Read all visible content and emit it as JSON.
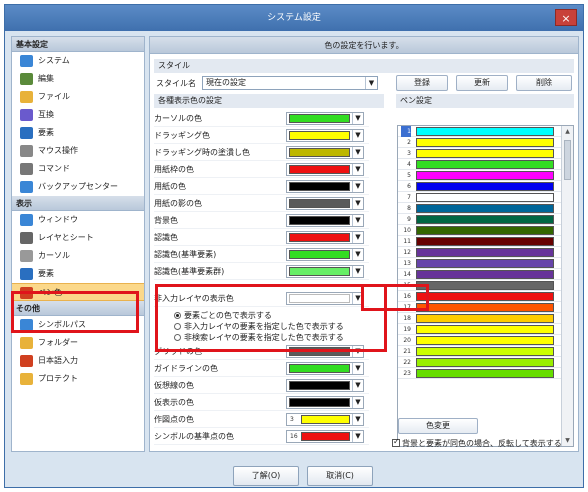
{
  "window": {
    "title": "システム設定",
    "close": "×"
  },
  "left": {
    "sections": [
      {
        "header": "基本設定",
        "items": [
          {
            "label": "システム",
            "icon": "monitor-icon"
          },
          {
            "label": "編集",
            "icon": "pencil-icon"
          },
          {
            "label": "ファイル",
            "icon": "folder-icon"
          },
          {
            "label": "互換",
            "icon": "compat-icon"
          },
          {
            "label": "要素",
            "icon": "element-icon"
          },
          {
            "label": "マウス操作",
            "icon": "mouse-icon"
          },
          {
            "label": "コマンド",
            "icon": "gear-icon"
          },
          {
            "label": "バックアップセンター",
            "icon": "backup-icon"
          }
        ]
      },
      {
        "header": "表示",
        "items": [
          {
            "label": "ウィンドウ",
            "icon": "window-icon"
          },
          {
            "label": "レイヤとシート",
            "icon": "layers-icon"
          },
          {
            "label": "カーソル",
            "icon": "cursor-icon"
          },
          {
            "label": "要素",
            "icon": "element-icon"
          },
          {
            "label": "ペン色",
            "icon": "pen-color-icon",
            "selected": true
          }
        ]
      },
      {
        "header": "その他",
        "items": [
          {
            "label": "シンボルパス",
            "icon": "symbol-icon"
          },
          {
            "label": "フォルダー",
            "icon": "folder-icon"
          },
          {
            "label": "日本語入力",
            "icon": "ime-icon"
          },
          {
            "label": "プロテクト",
            "icon": "lock-icon"
          }
        ]
      }
    ]
  },
  "right": {
    "header": "色の設定を行います。",
    "style_section": "スタイル",
    "style_name_label": "スタイル名",
    "style_name_value": "現在の設定",
    "buttons": {
      "register": "登録",
      "update": "更新",
      "delete": "削除"
    },
    "colors_section": "各種表示色の設定",
    "pen_section": "ペン設定",
    "color_rows": [
      {
        "label": "カーソルの色",
        "color": "#33dd22"
      },
      {
        "label": "ドラッギング色",
        "color": "#ffff00"
      },
      {
        "label": "ドラッギング時の塗潰し色",
        "color": "#bdb700"
      },
      {
        "label": "用紙枠の色",
        "color": "#ee1111"
      },
      {
        "label": "用紙の色",
        "color": "#000000"
      },
      {
        "label": "用紙の影の色",
        "color": "#5a5a5a"
      },
      {
        "label": "背景色",
        "color": "#000000"
      },
      {
        "label": "認識色",
        "color": "#ee1111"
      },
      {
        "label": "認識色(基準要素)",
        "color": "#33dd22"
      },
      {
        "label": "認識色(基準要素群)",
        "color": "#66ee66"
      }
    ],
    "inactive_layer": {
      "label": "非入力レイヤの表示色",
      "color": "#ffffff",
      "options": [
        {
          "label": "要素ごとの色で表示する",
          "checked": true
        },
        {
          "label": "非入力レイヤの要素を指定した色で表示する",
          "checked": false
        },
        {
          "label": "非検索レイヤの要素を指定した色で表示する",
          "checked": false
        }
      ]
    },
    "color_rows_2": [
      {
        "label": "グリッドの色",
        "color": "#5a5a5a"
      },
      {
        "label": "ガイドラインの色",
        "color": "#33dd22"
      },
      {
        "label": "仮想線の色",
        "color": "#000000"
      },
      {
        "label": "仮表示の色",
        "color": "#000000"
      },
      {
        "label": "作図点の色",
        "color": "#ffff00",
        "num": "3"
      },
      {
        "label": "シンボルの基準点の色",
        "color": "#ee1111",
        "num": "16"
      }
    ],
    "pens": [
      {
        "num": "1",
        "color": "#00ffff"
      },
      {
        "num": "2",
        "color": "#ffff00"
      },
      {
        "num": "3",
        "color": "#ffff00"
      },
      {
        "num": "4",
        "color": "#33dd22"
      },
      {
        "num": "5",
        "color": "#ff00ff"
      },
      {
        "num": "6",
        "color": "#0000ee"
      },
      {
        "num": "7",
        "color": "#ffffff"
      },
      {
        "num": "8",
        "color": "#006699"
      },
      {
        "num": "9",
        "color": "#006644"
      },
      {
        "num": "10",
        "color": "#336600"
      },
      {
        "num": "11",
        "color": "#660000"
      },
      {
        "num": "12",
        "color": "#663399"
      },
      {
        "num": "13",
        "color": "#6644aa"
      },
      {
        "num": "14",
        "color": "#663399"
      },
      {
        "num": "15",
        "color": "#666666"
      },
      {
        "num": "16",
        "color": "#ee1111"
      },
      {
        "num": "17",
        "color": "#ff5500"
      },
      {
        "num": "18",
        "color": "#ffcc00"
      },
      {
        "num": "19",
        "color": "#ffff00"
      },
      {
        "num": "20",
        "color": "#ffff00"
      },
      {
        "num": "21",
        "color": "#ccff00"
      },
      {
        "num": "22",
        "color": "#99ee00"
      },
      {
        "num": "23",
        "color": "#66dd00"
      }
    ],
    "change_color_button": "色変更",
    "invert_checkbox": "背景と要素が同色の場合、反転して表示する",
    "invert_checked": true
  },
  "footer": {
    "ok": "了解(O)",
    "cancel": "取消(C)"
  }
}
